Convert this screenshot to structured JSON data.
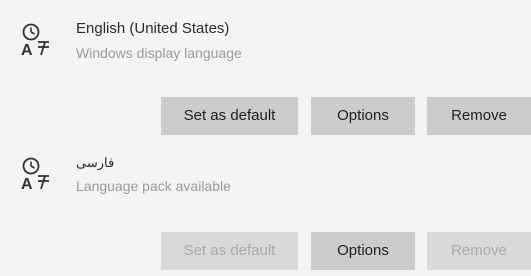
{
  "languages": [
    {
      "name": "English (United States)",
      "subtitle": "Windows display language",
      "icon": "language-icon",
      "buttons": {
        "set_default": "Set as default",
        "options": "Options",
        "remove": "Remove"
      },
      "set_default_enabled": true,
      "remove_enabled": true
    },
    {
      "name": "فارسی",
      "subtitle": "Language pack available",
      "icon": "language-icon",
      "buttons": {
        "set_default": "Set as default",
        "options": "Options",
        "remove": "Remove"
      },
      "set_default_enabled": false,
      "remove_enabled": false
    }
  ],
  "colors": {
    "background": "#f4f4f4",
    "button": "#cccccc",
    "button_disabled": "#d9d9d9",
    "text_disabled": "#a8a8a8"
  }
}
